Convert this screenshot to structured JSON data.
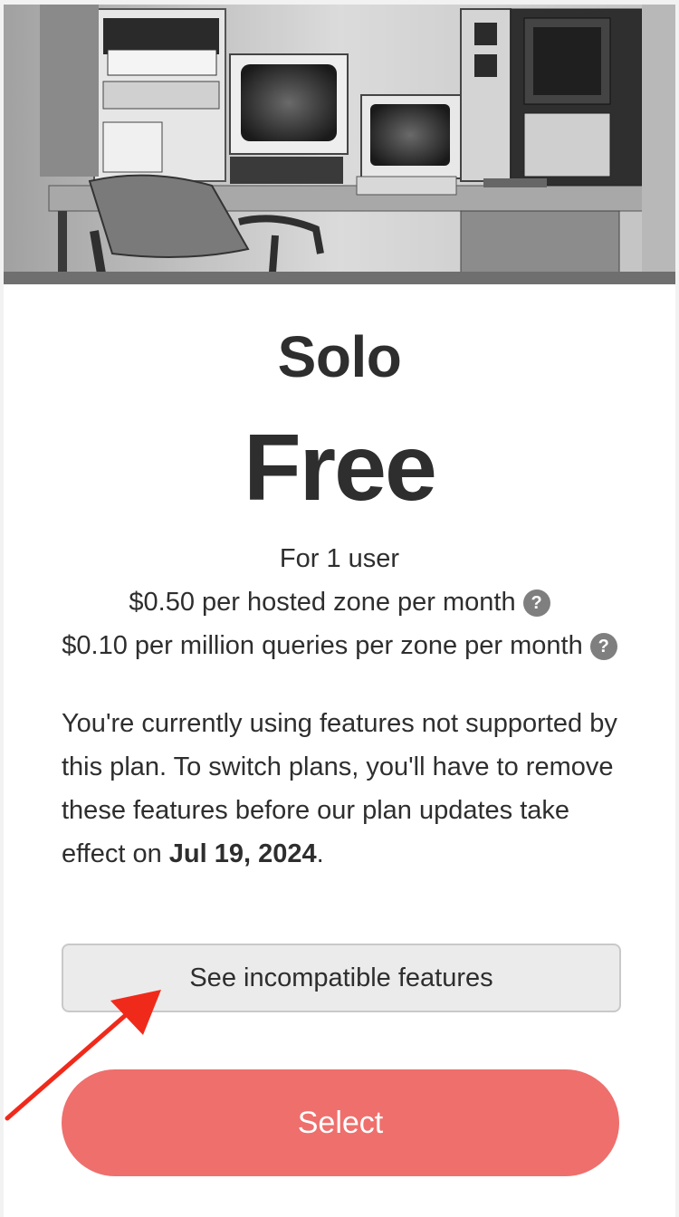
{
  "plan": {
    "name": "Solo",
    "price": "Free",
    "users_line": "For 1 user",
    "zone_price": "$0.50 per hosted zone per month",
    "query_price": "$0.10 per million queries per zone per month",
    "help_glyph": "?"
  },
  "notice": {
    "text": "You're currently using features not supported by this plan. To switch plans, you'll have to remove these features before our plan updates take effect on ",
    "date": "Jul 19, 2024",
    "end": "."
  },
  "buttons": {
    "incompatible_label": "See incompatible features",
    "select_label": "Select"
  },
  "colors": {
    "select_bg": "#ee6f6c",
    "annotation_arrow": "#f02a1b",
    "help_icon_bg": "#7f7f7f"
  },
  "icons": {
    "help": "question-circle-icon",
    "annotation": "red-arrow-annotation"
  }
}
